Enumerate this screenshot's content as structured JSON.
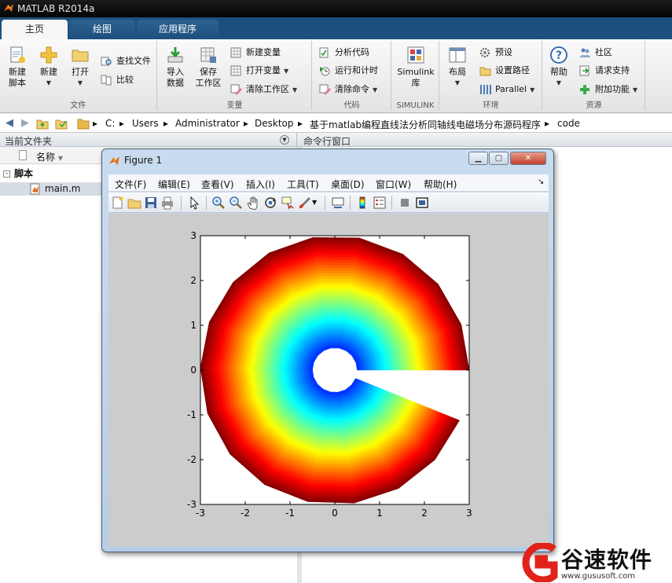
{
  "window": {
    "title": "MATLAB R2014a"
  },
  "tabs": [
    "主页",
    "绘图",
    "应用程序"
  ],
  "ribbon": {
    "file": {
      "label": "文件",
      "new_script": "新建\n脚本",
      "new": "新建",
      "open": "打开",
      "find_files": "查找文件",
      "compare": "比较"
    },
    "variable": {
      "label": "变量",
      "import_data": "导入\n数据",
      "save_workspace": "保存\n工作区",
      "new_variable": "新建变量",
      "open_variable": "打开变量",
      "clear_workspace": "清除工作区"
    },
    "code": {
      "label": "代码",
      "analyze_code": "分析代码",
      "run_and_time": "运行和计时",
      "clear_commands": "清除命令"
    },
    "simulink": {
      "label": "SIMULINK",
      "simulink_library": "Simulink\n库"
    },
    "environment": {
      "label": "环境",
      "layout": "布局",
      "preferences": "预设",
      "set_path": "设置路径",
      "parallel": "Parallel"
    },
    "resources": {
      "label": "资源",
      "help": "帮助",
      "community": "社区",
      "request_support": "请求支持",
      "add_ons": "附加功能"
    }
  },
  "address": {
    "path": [
      "C:",
      "Users",
      "Administrator",
      "Desktop",
      "基于matlab编程直线法分析同轴线电磁场分布源码程序",
      "code"
    ]
  },
  "panels": {
    "current_folder": "当前文件夹",
    "command_window": "命令行窗口",
    "column_name": "名称",
    "tree_group": "脚本",
    "tree_file": "main.m"
  },
  "figure": {
    "title": "Figure 1",
    "menus": [
      "文件(F)",
      "编辑(E)",
      "查看(V)",
      "插入(I)",
      "工具(T)",
      "桌面(D)",
      "窗口(W)",
      "帮助(H)"
    ]
  },
  "chart_data": {
    "type": "heatmap",
    "title": "",
    "xlabel": "",
    "ylabel": "",
    "xlim": [
      -3,
      3
    ],
    "ylim": [
      -3,
      3
    ],
    "xticks": [
      -3,
      -2,
      -1,
      0,
      1,
      2,
      3
    ],
    "yticks": [
      -3,
      -2,
      -1,
      0,
      1,
      2,
      3
    ],
    "colormap": "jet",
    "inner_radius": 0.5,
    "outer_radius": 3,
    "polygon_sides": 17,
    "angle_range_deg": [
      0,
      338
    ],
    "grid": false
  },
  "watermark": {
    "name": "谷速软件",
    "url": "www.gususoft.com"
  }
}
